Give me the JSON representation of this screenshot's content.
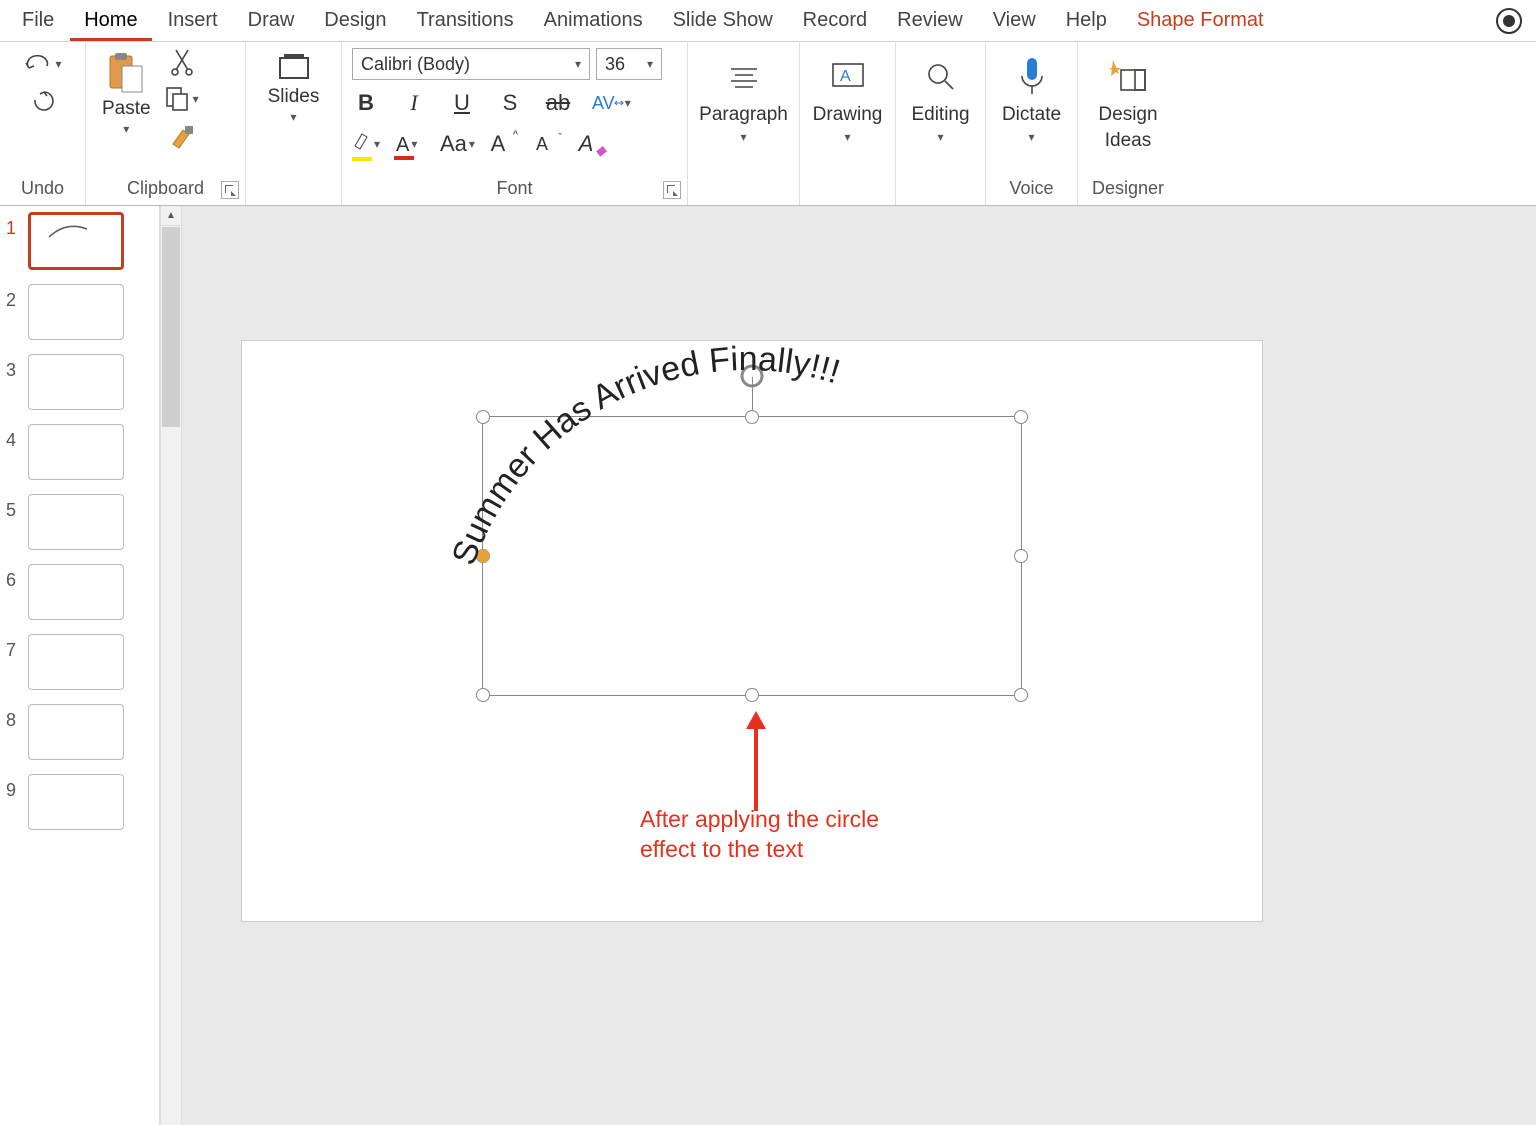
{
  "tabs": {
    "file": "File",
    "home": "Home",
    "insert": "Insert",
    "draw": "Draw",
    "design": "Design",
    "transitions": "Transitions",
    "animations": "Animations",
    "slideshow": "Slide Show",
    "record": "Record",
    "review": "Review",
    "view": "View",
    "help": "Help",
    "shape_format": "Shape Format"
  },
  "ribbon": {
    "undo_group": "Undo",
    "clipboard_group": "Clipboard",
    "paste": "Paste",
    "slides": "Slides",
    "font_group": "Font",
    "font_name": "Calibri (Body)",
    "font_size": "36",
    "paragraph": "Paragraph",
    "drawing": "Drawing",
    "editing": "Editing",
    "dictate": "Dictate",
    "voice": "Voice",
    "design_ideas_l1": "Design",
    "design_ideas_l2": "Ideas",
    "designer": "Designer",
    "aa": "Aa"
  },
  "thumbs": [
    "1",
    "2",
    "3",
    "4",
    "5",
    "6",
    "7",
    "8",
    "9"
  ],
  "slide": {
    "text": "Summer Has Arrived Finally!!!"
  },
  "annotation": {
    "line1": "After applying the circle",
    "line2": "effect to the text"
  }
}
